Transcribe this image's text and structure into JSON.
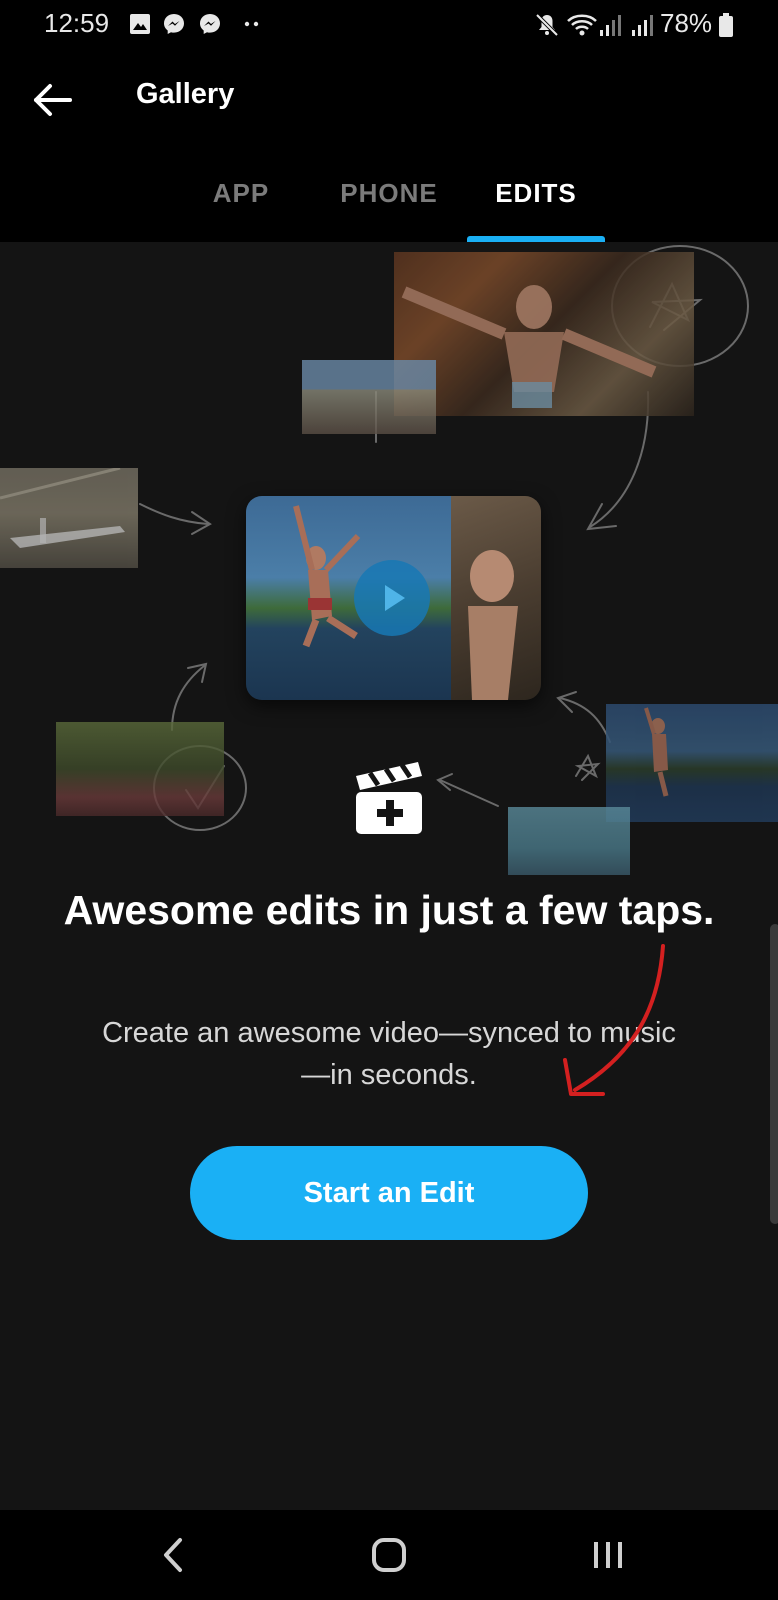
{
  "status_bar": {
    "time": "12:59",
    "battery": "78%",
    "left_icons": [
      "image-icon",
      "messenger-icon",
      "messenger-icon",
      "more-dots-icon"
    ],
    "right_icons": [
      "mute-icon",
      "wifi-icon",
      "signal-icon",
      "signal-icon",
      "battery-icon"
    ]
  },
  "app_bar": {
    "title": "Gallery"
  },
  "tabs": [
    {
      "label": "APP",
      "active": false
    },
    {
      "label": "PHONE",
      "active": false
    },
    {
      "label": "EDITS",
      "active": true
    }
  ],
  "empty_state": {
    "headline": "Awesome edits in just a few taps.",
    "subline": "Create an awesome video—synced to music—in seconds.",
    "cta_label": "Start an Edit"
  },
  "colors": {
    "accent": "#1ab0f5",
    "background": "#141414",
    "annotation": "#d42020"
  }
}
